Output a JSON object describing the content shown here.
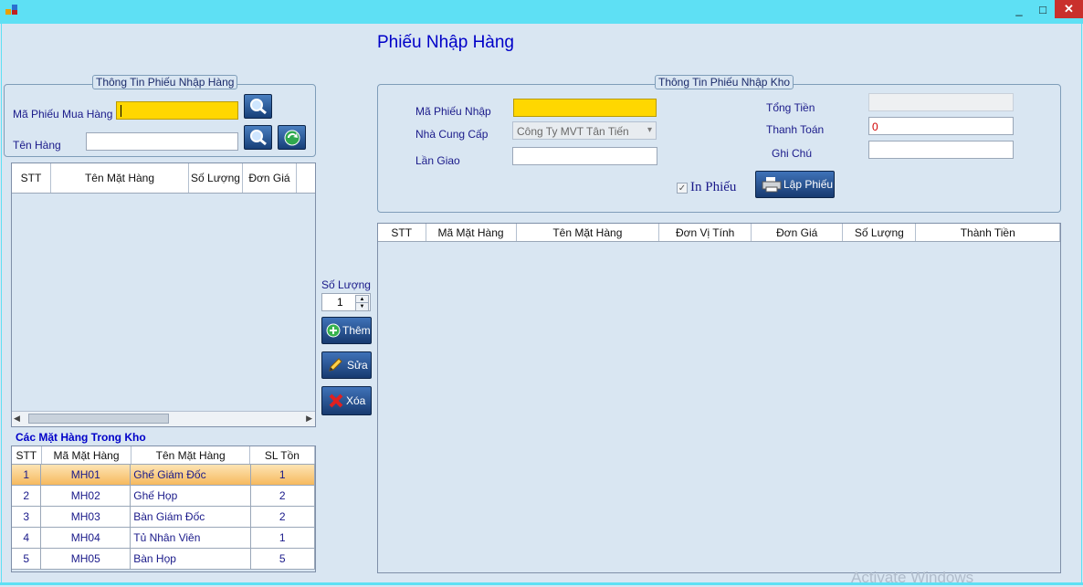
{
  "window": {
    "minimize": "_",
    "maximize": "□",
    "close": "✕"
  },
  "form_title": "Phiếu Nhập Hàng",
  "left_group": {
    "legend": "Thông Tin Phiếu Nhập Hàng",
    "ma_phieu_label": "Mã Phiếu Mua Hàng",
    "ma_phieu_value": "",
    "ten_hang_label": "Tên Hàng",
    "ten_hang_value": ""
  },
  "product_grid": {
    "columns": [
      "STT",
      "Tên Mặt Hàng",
      "Số Lượng",
      "Đơn Giá"
    ]
  },
  "middle": {
    "so_luong_label": "Số Lượng",
    "so_luong_value": "1",
    "them_label": "Thêm",
    "sua_label": "Sửa",
    "xoa_label": "Xóa"
  },
  "stock": {
    "title": "Các Mặt Hàng Trong Kho",
    "columns": [
      "STT",
      "Mã Mặt Hàng",
      "Tên Mặt Hàng",
      "SL Tồn"
    ],
    "rows": [
      {
        "stt": "1",
        "ma": "MH01",
        "ten": "Ghế Giám Đốc",
        "sl": "1"
      },
      {
        "stt": "2",
        "ma": "MH02",
        "ten": "Ghế Họp",
        "sl": "2"
      },
      {
        "stt": "3",
        "ma": "MH03",
        "ten": "Bàn Giám Đốc",
        "sl": "2"
      },
      {
        "stt": "4",
        "ma": "MH04",
        "ten": "Tủ Nhân Viên",
        "sl": "1"
      },
      {
        "stt": "5",
        "ma": "MH05",
        "ten": "Bàn Họp",
        "sl": "5"
      }
    ]
  },
  "right_group": {
    "legend": "Thông Tin Phiếu Nhập Kho",
    "ma_phieu_nhap_label": "Mã Phiếu Nhập",
    "ma_phieu_nhap_value": "",
    "nha_cung_cap_label": "Nhà Cung Cấp",
    "nha_cung_cap_value": "Công Ty MVT Tân Tiến",
    "lan_giao_label": "Lần Giao",
    "lan_giao_value": "",
    "tong_tien_label": "Tổng Tiền",
    "tong_tien_value": "",
    "thanh_toan_label": "Thanh Toán",
    "thanh_toan_value": "0",
    "ghi_chu_label": "Ghi Chú",
    "ghi_chu_value": "",
    "in_phieu_label": "In Phiếu",
    "in_phieu_checked": true,
    "lap_phieu_label": "Lập Phiếu"
  },
  "detail_grid": {
    "columns": [
      "STT",
      "Mã Mặt Hàng",
      "Tên Mặt Hàng",
      "Đơn Vị Tính",
      "Đơn Giá",
      "Số Lượng",
      "Thành Tiền"
    ]
  },
  "watermark": "Activate Windows",
  "colors": {
    "titlebar": "#5ee0f4",
    "background": "#d9e6f2",
    "highlight": "#ffd700",
    "selected_row": "#f6b95e"
  }
}
